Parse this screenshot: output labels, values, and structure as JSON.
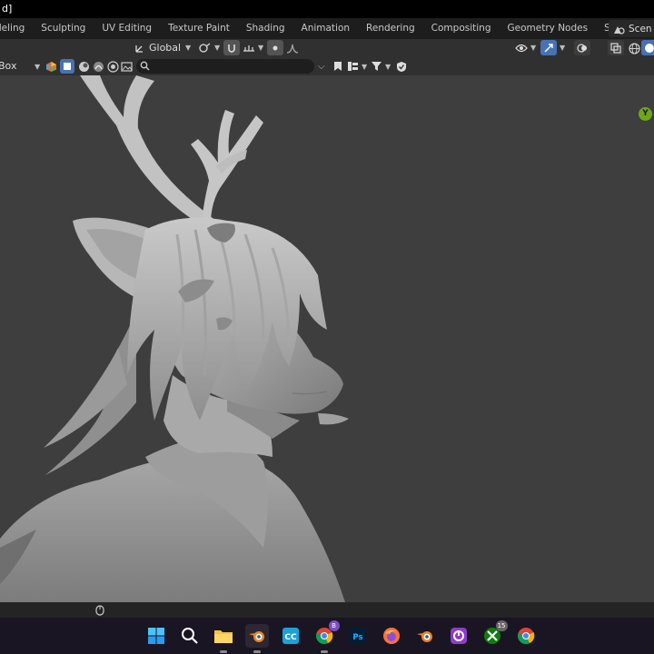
{
  "window": {
    "title_fragment": "d]"
  },
  "workspace_tabs": [
    "deling",
    "Sculpting",
    "UV Editing",
    "Texture Paint",
    "Shading",
    "Animation",
    "Rendering",
    "Compositing",
    "Geometry Nodes",
    "Scripting"
  ],
  "scene_label": "Scen",
  "header": {
    "orientation_label": "Global",
    "select_mode_label": "Box"
  },
  "search": {
    "placeholder": ""
  },
  "navigation_gizmo": {
    "axis_label": "Y",
    "axis_color": "#6ea61a"
  },
  "taskbar": {
    "xbox_badge": "15",
    "chrome_badge": "B"
  },
  "colors": {
    "accent": "#4772b3",
    "viewport_bg": "#3e3e3e",
    "header_bg": "#303030"
  }
}
